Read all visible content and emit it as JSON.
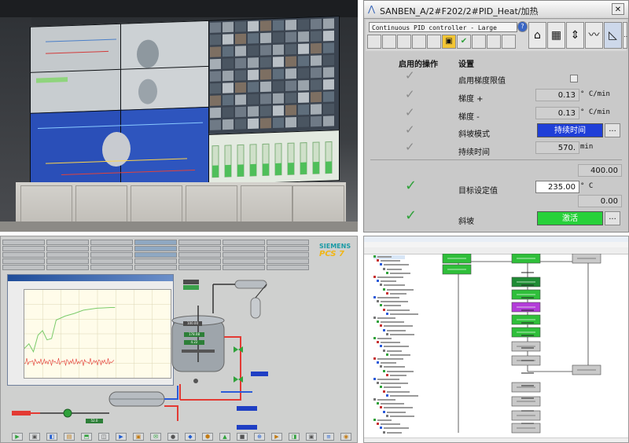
{
  "faceplate": {
    "window_title": "SANBEN_A/2#F202/2#PID_Heat/加热",
    "controller_type": "Continuous PID controller - Large",
    "col_enabled_ops": "启用的操作",
    "col_settings": "设置",
    "rows": [
      {
        "label": "启用梯度限值",
        "checkbox": true
      },
      {
        "label": "梯度 +",
        "value": "0.13",
        "unit": "° C/min"
      },
      {
        "label": "梯度 -",
        "value": "0.13",
        "unit": "° C/min"
      },
      {
        "label": "斜坡模式",
        "button": "持续时间"
      },
      {
        "label": "持续时间",
        "value": "570.",
        "unit": "min"
      }
    ],
    "upper_limit": "400.00",
    "setpoint_label": "目标设定值",
    "setpoint_value": "235.00",
    "setpoint_unit": "° C",
    "lower_limit": "0.00",
    "ramp_label": "斜坡",
    "ramp_button": "激活",
    "ellipsis": "...",
    "close_glyph": "✕"
  },
  "pcs7": {
    "brand_line1": "SIEMENS",
    "brand_line2": "PCS 7",
    "readout_1": "178.08",
    "readout_2": "4.22",
    "readout_3": "52.0",
    "readout_4": "100.00",
    "trend_points": [
      [
        0,
        0.35
      ],
      [
        0.05,
        0.42
      ],
      [
        0.1,
        0.3
      ],
      [
        0.15,
        0.55
      ],
      [
        0.2,
        0.62
      ],
      [
        0.25,
        0.48
      ],
      [
        0.3,
        0.5
      ],
      [
        0.35,
        0.78
      ],
      [
        0.45,
        0.84
      ],
      [
        0.55,
        0.88
      ],
      [
        0.65,
        0.93
      ],
      [
        0.8,
        0.96
      ],
      [
        0.95,
        0.97
      ],
      [
        1.0,
        0.97
      ]
    ]
  },
  "colors": {
    "ramp_mode_blue": "#1f3fd8",
    "ramp_active_green": "#27d13a",
    "check_green": "#2fa23a",
    "pcs7_teal": "#1a9aa6",
    "pcs7_yellow": "#f1b514"
  }
}
